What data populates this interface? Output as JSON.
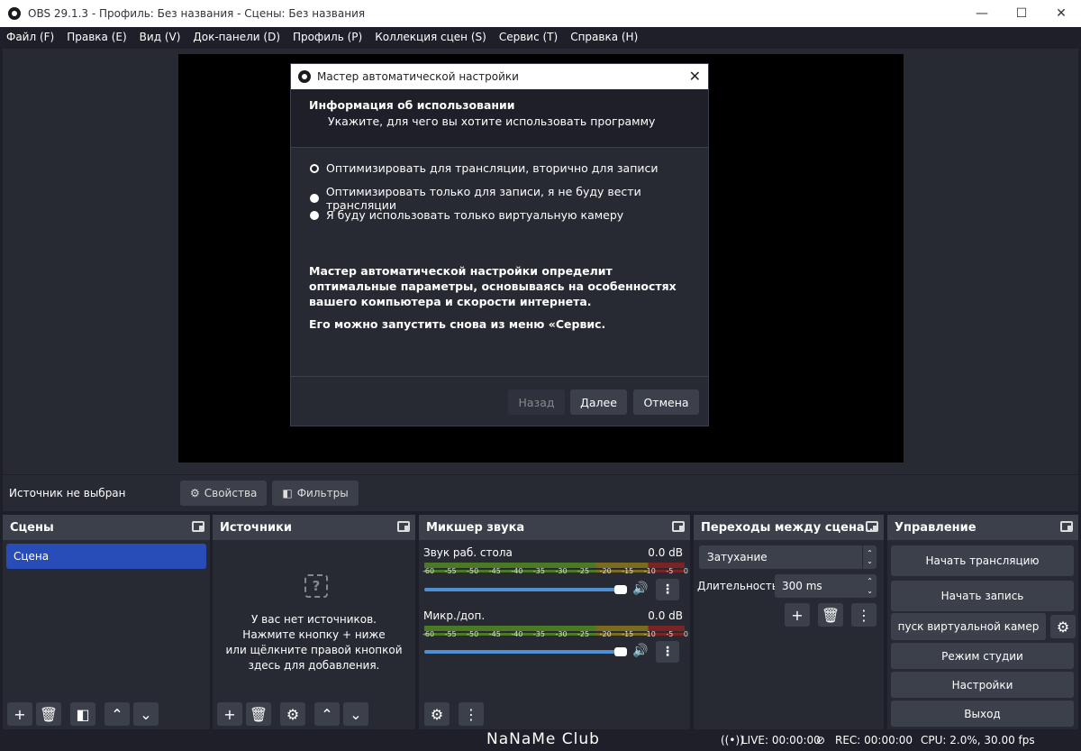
{
  "window": {
    "title": "OBS 29.1.3 - Профиль: Без названия - Сцены: Без названия",
    "minimize": "—",
    "maximize": "☐",
    "close": "✕"
  },
  "menu": [
    "Файл (F)",
    "Правка (E)",
    "Вид (V)",
    "Док-панели (D)",
    "Профиль (P)",
    "Коллекция сцен (S)",
    "Сервис (T)",
    "Справка (H)"
  ],
  "source_bar": {
    "no_source": "Источник не выбран",
    "properties": "Свойства",
    "filters": "Фильтры"
  },
  "scenes": {
    "title": "Сцены",
    "items": [
      "Сцена"
    ]
  },
  "sources": {
    "title": "Источники",
    "empty_lines": [
      "У вас нет источников.",
      "Нажмите кнопку + ниже",
      "или щёлкните правой кнопкой",
      "здесь для добавления."
    ]
  },
  "mixer": {
    "title": "Микшер звука",
    "ticks": [
      "-60",
      "-55",
      "-50",
      "-45",
      "-40",
      "-35",
      "-30",
      "-25",
      "-20",
      "-15",
      "-10",
      "-5",
      "0"
    ],
    "channels": [
      {
        "name": "Звук раб. стола",
        "db": "0.0 dB",
        "volume": 1.0
      },
      {
        "name": "Микр./доп.",
        "db": "0.0 dB",
        "volume": 1.0
      }
    ]
  },
  "transitions": {
    "title": "Переходы между сцена...",
    "selected": "Затухание",
    "duration_label": "Длительность",
    "duration_value": "300 ms"
  },
  "controls": {
    "title": "Управление",
    "start_stream": "Начать трансляцию",
    "start_record": "Начать запись",
    "virtual_cam": "пуск виртуальной камер",
    "studio_mode": "Режим студии",
    "settings": "Настройки",
    "exit": "Выход"
  },
  "status": {
    "watermark": "NaNaMe Club",
    "live": "LIVE: 00:00:00",
    "rec": "REC: 00:00:00",
    "cpu": "CPU: 2.0%, 30.00 fps"
  },
  "dialog": {
    "title": "Мастер автоматической настройки",
    "heading": "Информация об использовании",
    "subheading": "Укажите, для чего вы хотите использовать программу",
    "options": [
      {
        "label": "Оптимизировать для трансляции, вторично для записи",
        "selected": true
      },
      {
        "label": "Оптимизировать только для записи, я не буду вести трансляции",
        "selected": false
      },
      {
        "label": "Я буду использовать только виртуальную камеру",
        "selected": false
      }
    ],
    "description": "Мастер автоматической настройки определит оптимальные параметры, основываясь на особенностях вашего компьютера и скорости интернета.",
    "note": "Его можно запустить снова из меню «Сервис.",
    "back": "Назад",
    "next": "Далее",
    "cancel": "Отмена"
  }
}
